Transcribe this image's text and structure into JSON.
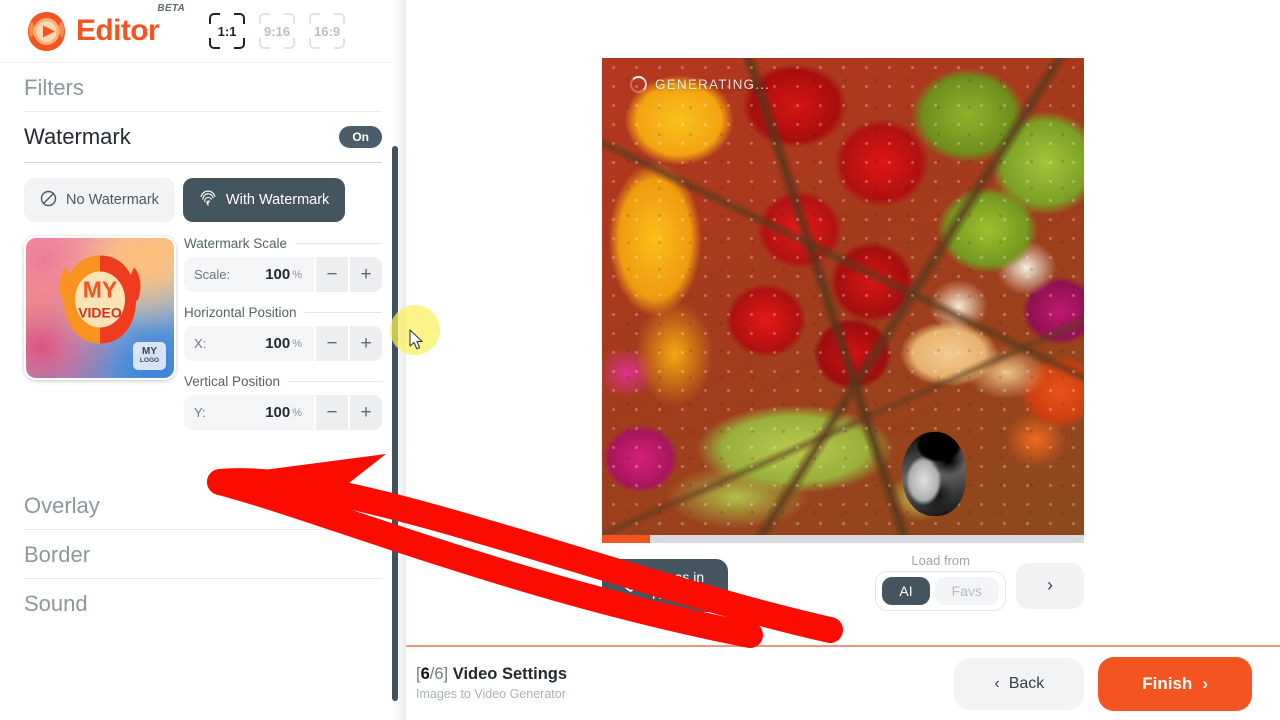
{
  "brand": {
    "name": "Editor",
    "badge": "BETA",
    "accent": "#f4541f",
    "slate": "#44555f"
  },
  "topbar": {
    "ratios": [
      {
        "label": "1:1",
        "active": true
      },
      {
        "label": "9:16",
        "active": false
      },
      {
        "label": "16:9",
        "active": false
      }
    ]
  },
  "sidebar": {
    "filters_label": "Filters",
    "watermark": {
      "title": "Watermark",
      "toggle_label": "On",
      "options": [
        {
          "label": "No Watermark",
          "icon": "no-symbol-icon",
          "selected": false
        },
        {
          "label": "With Watermark",
          "icon": "fingerprint-icon",
          "selected": true
        }
      ],
      "thumb": {
        "line1": "MY",
        "line2": "VIDEO",
        "badge1": "MY",
        "badge2": "LOGO"
      },
      "controls": [
        {
          "label": "Watermark Scale",
          "key": "Scale:",
          "value": "100",
          "unit": "%",
          "minus": "−",
          "plus": "+"
        },
        {
          "label": "Horizontal Position",
          "key": "X:",
          "value": "100",
          "unit": "%",
          "minus": "−",
          "plus": "+"
        },
        {
          "label": "Vertical Position",
          "key": "Y:",
          "value": "100",
          "unit": "%",
          "minus": "−",
          "plus": "+"
        }
      ]
    },
    "sections": [
      {
        "label": "Overlay"
      },
      {
        "label": "Border"
      },
      {
        "label": "Sound"
      }
    ]
  },
  "preview": {
    "status": "GENERATING...",
    "progress_percent": 10,
    "favorite_chip": "Lucas in Haifa",
    "load_from_caption": "Load from",
    "load_from_options": [
      {
        "label": "AI",
        "selected": true
      },
      {
        "label": "Favs",
        "selected": false
      }
    ],
    "next_label": "›"
  },
  "footer": {
    "step_current": "6",
    "step_rest": "/6]",
    "step_open": "[",
    "step_title": "Video Settings",
    "step_sub": "Images to Video Generator",
    "back_label": "Back",
    "back_chevron": "‹",
    "finish_label": "Finish",
    "finish_chevron": "›"
  }
}
